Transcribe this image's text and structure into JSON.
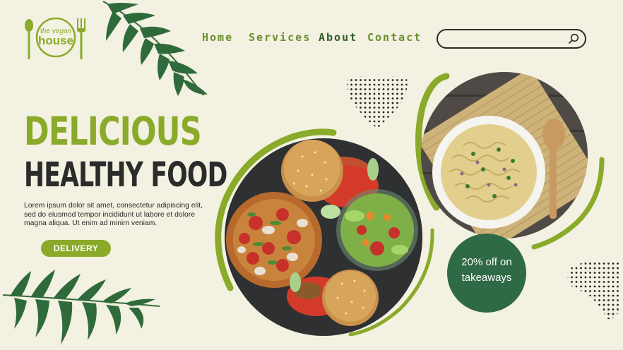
{
  "logo": {
    "line1": "the vegan",
    "line2": "house"
  },
  "nav": {
    "home": "Home",
    "services": "Services",
    "about": "About",
    "contact": "Contact"
  },
  "search": {
    "placeholder": ""
  },
  "hero": {
    "title_line1": "DELICIOUS",
    "title_line2": "HEALTHY FOOD",
    "body": "Lorem ipsum dolor sit amet, consectetur adipiscing elit, sed do eiusmod tempor incididunt ut labore et dolore magna aliqua. Ut enim ad minim veniam.",
    "cta_label": "DELIVERY"
  },
  "promo": {
    "line1": "20% off on",
    "line2": "takeaways"
  },
  "colors": {
    "background": "#f3f1e1",
    "accent_green": "#8aaa2a",
    "dark_green": "#2e6a45",
    "leaf": "#2f6b3a",
    "text": "#2b2b2b"
  },
  "icons": [
    "spoon-icon",
    "fork-icon",
    "search-icon",
    "palm-leaf-icon",
    "dot-pattern-icon"
  ]
}
